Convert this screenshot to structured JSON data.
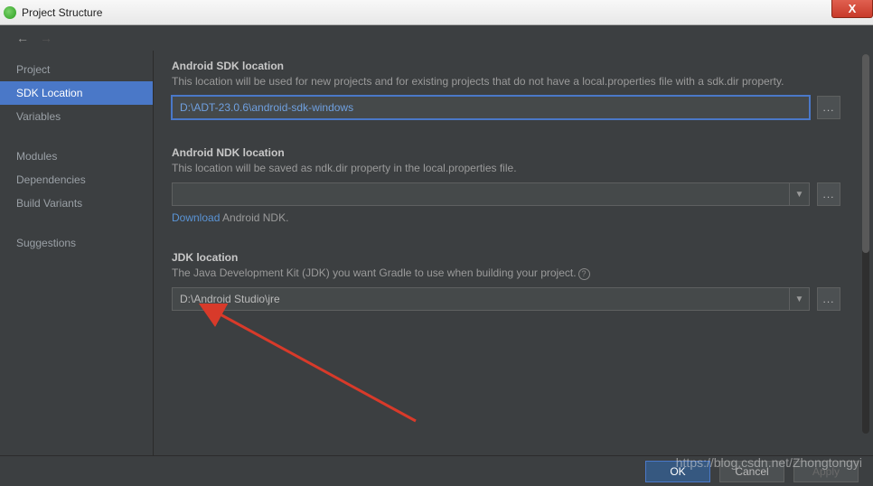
{
  "window": {
    "title": "Project Structure",
    "close": "X"
  },
  "sidebar": {
    "items": [
      {
        "label": "Project"
      },
      {
        "label": "SDK Location"
      },
      {
        "label": "Variables"
      },
      {
        "label": "Modules"
      },
      {
        "label": "Dependencies"
      },
      {
        "label": "Build Variants"
      },
      {
        "label": "Suggestions"
      }
    ]
  },
  "sections": {
    "sdk": {
      "title": "Android SDK location",
      "desc": "This location will be used for new projects and for existing projects that do not have a local.properties file with a sdk.dir property.",
      "value": "D:\\ADT-23.0.6\\android-sdk-windows",
      "browse": "..."
    },
    "ndk": {
      "title": "Android NDK location",
      "desc": "This location will be saved as ndk.dir property in the local.properties file.",
      "value": "",
      "download_link": "Download",
      "download_rest": " Android NDK.",
      "browse": "..."
    },
    "jdk": {
      "title": "JDK location",
      "desc": "The Java Development Kit (JDK) you want Gradle to use when building your project.",
      "value": "D:\\Android Studio\\jre",
      "browse": "..."
    }
  },
  "footer": {
    "ok": "OK",
    "cancel": "Cancel",
    "apply": "Apply"
  },
  "watermark": "https://blog.csdn.net/Zhongtongyi"
}
